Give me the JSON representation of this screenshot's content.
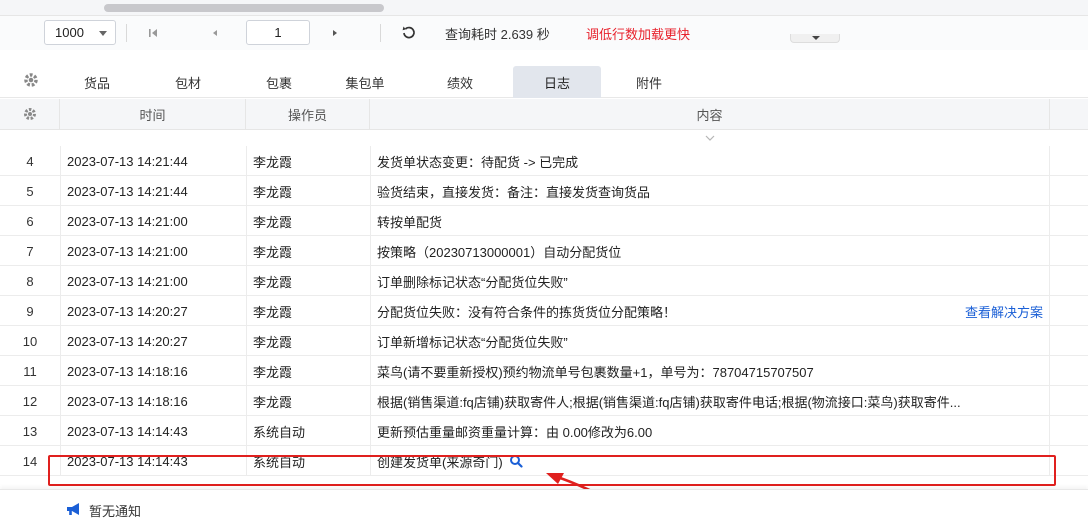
{
  "pager": {
    "page_size": "1000",
    "current_page": "1",
    "query_time": "查询耗时 2.639 秒",
    "tip": "调低行数加载更快"
  },
  "tabs": [
    {
      "label": "货品",
      "active": false
    },
    {
      "label": "包材",
      "active": false
    },
    {
      "label": "包裹",
      "active": false
    },
    {
      "label": "集包单",
      "active": false
    },
    {
      "label": "绩效",
      "active": false
    },
    {
      "label": "日志",
      "active": true
    },
    {
      "label": "附件",
      "active": false
    }
  ],
  "table": {
    "columns": [
      "时间",
      "操作员",
      "内容"
    ],
    "rows": [
      {
        "idx": "4",
        "time": "2023-07-13 14:21:44",
        "operator": "李龙霞",
        "content": "发货单状态变更：待配货 -> 已完成"
      },
      {
        "idx": "5",
        "time": "2023-07-13 14:21:44",
        "operator": "李龙霞",
        "content": "验货结束，直接发货：备注：直接发货查询货品"
      },
      {
        "idx": "6",
        "time": "2023-07-13 14:21:00",
        "operator": "李龙霞",
        "content": "转按单配货"
      },
      {
        "idx": "7",
        "time": "2023-07-13 14:21:00",
        "operator": "李龙霞",
        "content": "按策略（20230713000001）自动分配货位"
      },
      {
        "idx": "8",
        "time": "2023-07-13 14:21:00",
        "operator": "李龙霞",
        "content": "订单删除标记状态“分配货位失败”"
      },
      {
        "idx": "9",
        "time": "2023-07-13 14:20:27",
        "operator": "李龙霞",
        "content": "分配货位失败：没有符合条件的拣货货位分配策略！",
        "link": "查看解决方案"
      },
      {
        "idx": "10",
        "time": "2023-07-13 14:20:27",
        "operator": "李龙霞",
        "content": "订单新增标记状态“分配货位失败”"
      },
      {
        "idx": "11",
        "time": "2023-07-13 14:18:16",
        "operator": "李龙霞",
        "content": "菜鸟(请不要重新授权)预约物流单号包裹数量+1，单号为：78704715707507"
      },
      {
        "idx": "12",
        "time": "2023-07-13 14:18:16",
        "operator": "李龙霞",
        "content": "根据(销售渠道:fq店铺)获取寄件人;根据(销售渠道:fq店铺)获取寄件电话;根据(物流接口:菜鸟)获取寄件..."
      },
      {
        "idx": "13",
        "time": "2023-07-13 14:14:43",
        "operator": "系统自动",
        "content": "更新预估重量邮资重量计算：由 0.00修改为6.00"
      },
      {
        "idx": "14",
        "time": "2023-07-13 14:14:43",
        "operator": "系统自动",
        "content": "创建发货单(来源奇门)",
        "icon": "search-icon"
      }
    ]
  },
  "notify": {
    "text": "暂无通知",
    "icon": "megaphone-icon"
  },
  "colors": {
    "link": "#1a5fd6",
    "tip": "#e8212c",
    "highlight": "#e0201e",
    "active_tab": "#e2e6ed"
  }
}
